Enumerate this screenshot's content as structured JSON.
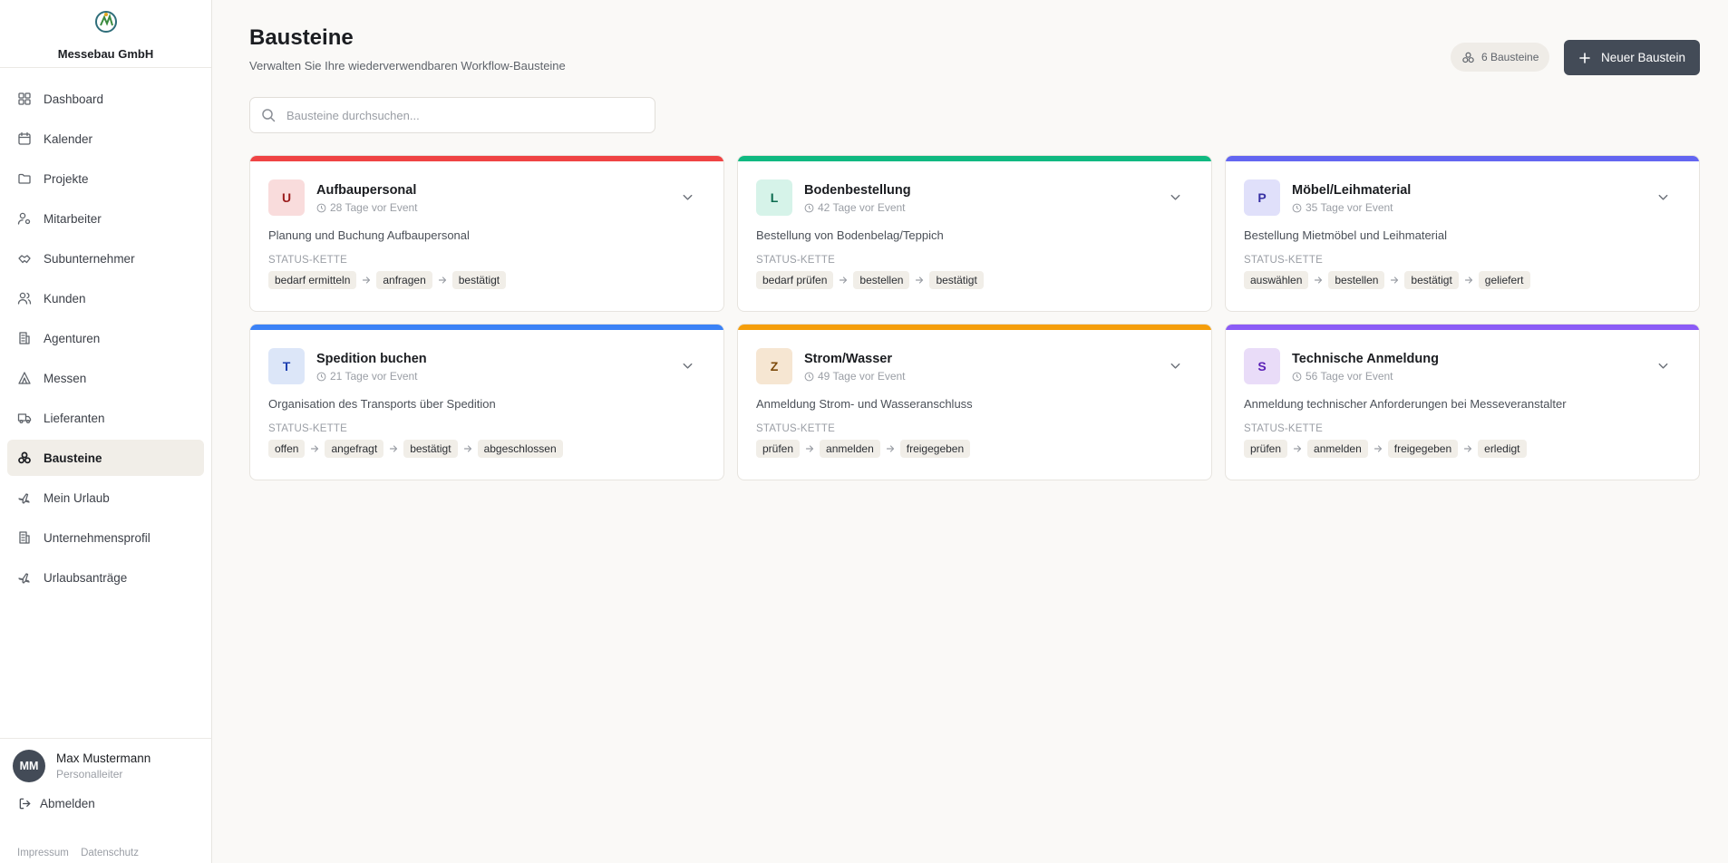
{
  "company": {
    "name": "Messebau GmbH"
  },
  "sidebar": {
    "items": [
      {
        "label": "Dashboard",
        "icon": "dashboard-icon",
        "active": false
      },
      {
        "label": "Kalender",
        "icon": "calendar-icon",
        "active": false
      },
      {
        "label": "Projekte",
        "icon": "folder-icon",
        "active": false
      },
      {
        "label": "Mitarbeiter",
        "icon": "user-cog-icon",
        "active": false
      },
      {
        "label": "Subunternehmer",
        "icon": "handshake-icon",
        "active": false
      },
      {
        "label": "Kunden",
        "icon": "users-icon",
        "active": false
      },
      {
        "label": "Agenturen",
        "icon": "building-icon",
        "active": false
      },
      {
        "label": "Messen",
        "icon": "tent-icon",
        "active": false
      },
      {
        "label": "Lieferanten",
        "icon": "truck-icon",
        "active": false
      },
      {
        "label": "Bausteine",
        "icon": "blocks-icon",
        "active": true
      },
      {
        "label": "Mein Urlaub",
        "icon": "plane-icon",
        "active": false
      },
      {
        "label": "Unternehmensprofil",
        "icon": "building-icon",
        "active": false
      },
      {
        "label": "Urlaubsanträge",
        "icon": "plane-icon",
        "active": false
      }
    ]
  },
  "user": {
    "initials": "MM",
    "name": "Max Mustermann",
    "role": "Personalleiter"
  },
  "logout_label": "Abmelden",
  "legal": {
    "impressum": "Impressum",
    "datenschutz": "Datenschutz"
  },
  "header": {
    "title": "Bausteine",
    "subtitle": "Verwalten Sie Ihre wiederverwendbaren Workflow-Bausteine",
    "count_badge": "6 Bausteine",
    "new_button": "Neuer Baustein"
  },
  "search": {
    "placeholder": "Bausteine durchsuchen..."
  },
  "chain_label": "STATUS-KETTE",
  "cards": [
    {
      "letter": "U",
      "title": "Aufbaupersonal",
      "days": "28 Tage vor Event",
      "description": "Planung und Buchung Aufbaupersonal",
      "accent": "#ef4444",
      "letter_bg": "#f9dcdc",
      "letter_color": "#9b1c1c",
      "chain": [
        "bedarf ermitteln",
        "anfragen",
        "bestätigt"
      ]
    },
    {
      "letter": "L",
      "title": "Bodenbestellung",
      "days": "42 Tage vor Event",
      "description": "Bestellung von Bodenbelag/Teppich",
      "accent": "#10b981",
      "letter_bg": "#d6f3e9",
      "letter_color": "#0b6b4f",
      "chain": [
        "bedarf prüfen",
        "bestellen",
        "bestätigt"
      ]
    },
    {
      "letter": "P",
      "title": "Möbel/Leihmaterial",
      "days": "35 Tage vor Event",
      "description": "Bestellung Mietmöbel und Leihmaterial",
      "accent": "#6366f1",
      "letter_bg": "#e0e0fa",
      "letter_color": "#3730a3",
      "chain": [
        "auswählen",
        "bestellen",
        "bestätigt",
        "geliefert"
      ]
    },
    {
      "letter": "T",
      "title": "Spedition buchen",
      "days": "21 Tage vor Event",
      "description": "Organisation des Transports über Spedition",
      "accent": "#3b82f6",
      "letter_bg": "#dce6f8",
      "letter_color": "#1e40af",
      "chain": [
        "offen",
        "angefragt",
        "bestätigt",
        "abgeschlossen"
      ]
    },
    {
      "letter": "Z",
      "title": "Strom/Wasser",
      "days": "49 Tage vor Event",
      "description": "Anmeldung Strom- und Wasseranschluss",
      "accent": "#f59e0b",
      "letter_bg": "#f6e6d2",
      "letter_color": "#7c4a0b",
      "chain": [
        "prüfen",
        "anmelden",
        "freigegeben"
      ]
    },
    {
      "letter": "S",
      "title": "Technische Anmeldung",
      "days": "56 Tage vor Event",
      "description": "Anmeldung technischer Anforderungen bei Messeveranstalter",
      "accent": "#8b5cf6",
      "letter_bg": "#e9dcf8",
      "letter_color": "#5b21b6",
      "chain": [
        "prüfen",
        "anmelden",
        "freigegeben",
        "erledigt"
      ]
    }
  ]
}
